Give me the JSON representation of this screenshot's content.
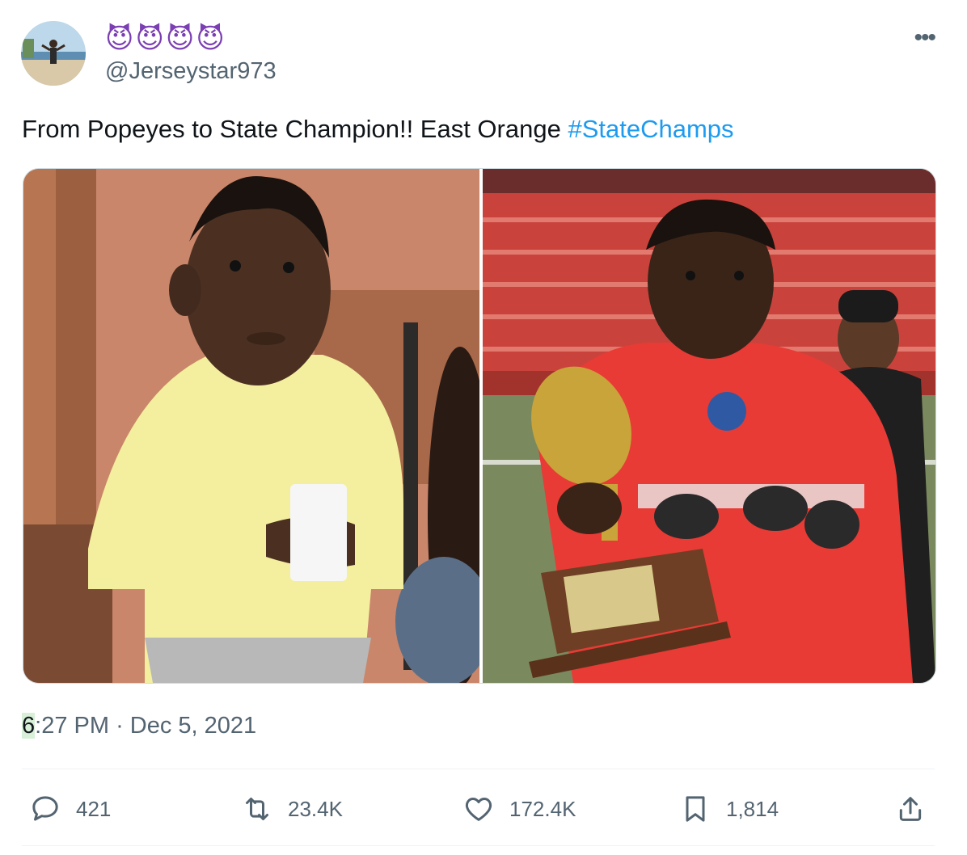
{
  "tweet": {
    "display_name": "😈😈😈😈",
    "handle": "@Jerseystar973",
    "text_plain": "From Popeyes to State Champion!! East Orange ",
    "hashtag": "#StateChamps",
    "timestamp_first": "6",
    "timestamp_rest": ":27 PM · Dec 5, 2021",
    "more_label": "•••"
  },
  "stats": {
    "replies": "421",
    "retweets": "23.4K",
    "likes": "172.4K",
    "bookmarks": "1,814"
  },
  "icons": [
    "reply-icon",
    "retweet-icon",
    "like-icon",
    "bookmark-icon",
    "share-icon",
    "more-icon"
  ],
  "colors": {
    "hashtag": "#1d9bf0",
    "meta": "#536471",
    "name": "#7b3fb3",
    "jersey": "#e83b35"
  }
}
